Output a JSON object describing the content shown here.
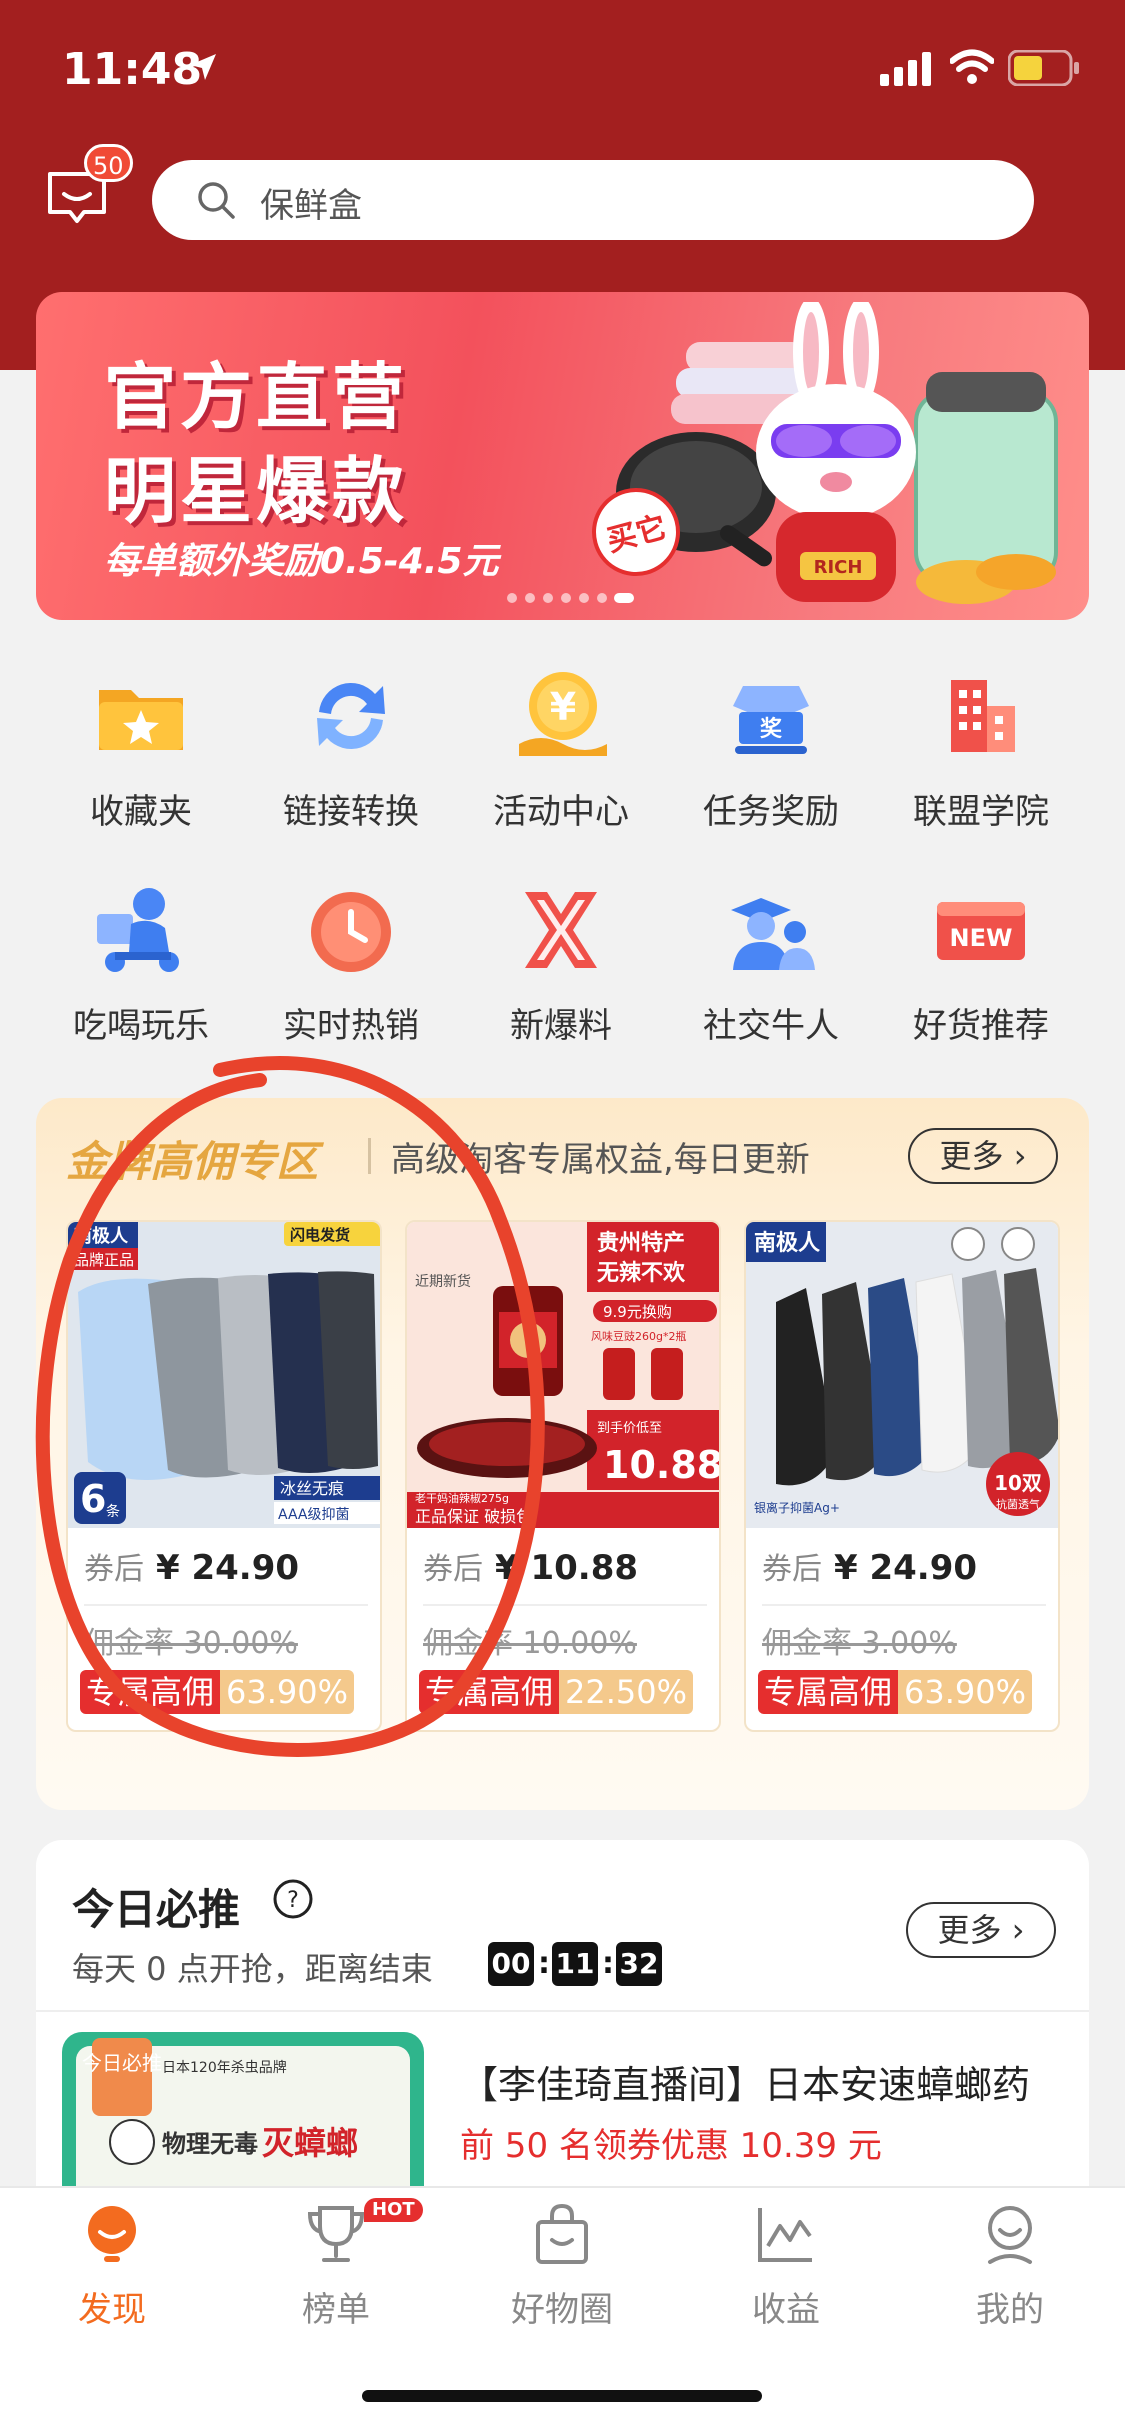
{
  "status_bar": {
    "time": "11:48"
  },
  "header": {
    "message_badge": "50",
    "search_placeholder": "保鲜盒"
  },
  "banner": {
    "title_line1": "官方直营",
    "title_line2": "明星爆款",
    "subtitle": "每单额外奖励0.5-4.5元",
    "stamp": "买它",
    "tag": "RICH"
  },
  "grid": {
    "items": [
      {
        "label": "收藏夹",
        "icon": "folder-star-icon"
      },
      {
        "label": "链接转换",
        "icon": "convert-arrows-icon"
      },
      {
        "label": "活动中心",
        "icon": "yuan-coin-icon"
      },
      {
        "label": "任务奖励",
        "icon": "award-icon"
      },
      {
        "label": "联盟学院",
        "icon": "buildings-icon"
      },
      {
        "label": "吃喝玩乐",
        "icon": "delivery-rider-icon"
      },
      {
        "label": "实时热销",
        "icon": "clock-icon"
      },
      {
        "label": "新爆料",
        "icon": "x-logo-icon"
      },
      {
        "label": "社交牛人",
        "icon": "graduate-people-icon"
      },
      {
        "label": "好货推荐",
        "icon": "new-badge-icon"
      }
    ]
  },
  "gold_zone": {
    "title": "金牌高佣专区",
    "subtitle": "高级淘客专属权益,每日更新",
    "more": "更多",
    "products": [
      {
        "price_prefix": "券后",
        "price": "¥ 24.90",
        "orig_rate": "佣金率 30.00%",
        "tag_label": "专属高佣",
        "tag_rate": "63.90%",
        "img_brand": "南极人",
        "img_badge": "闪电发货",
        "img_count": "6",
        "img_count_unit": "条",
        "img_note1": "冰丝无痕",
        "img_note2": "AAA级抑菌",
        "img_note3": "品牌正品"
      },
      {
        "price_prefix": "券后",
        "price": "¥ 10.88",
        "orig_rate": "佣金率 10.00%",
        "tag_label": "专属高佣",
        "tag_rate": "22.50%",
        "img_head1": "贵州特产",
        "img_head2": "无辣不欢",
        "img_promo": "9.9元换购",
        "img_promo2": "风味豆豉260g*2瓶",
        "img_label": "到手价低至",
        "img_price": "10.88",
        "img_foot": "正品保证 破损包",
        "img_bottle": "老干妈油辣椒275g",
        "img_fresh": "近期新货"
      },
      {
        "price_prefix": "券后",
        "price": "¥ 24.90",
        "orig_rate": "佣金率 3.00%",
        "tag_label": "专属高佣",
        "tag_rate": "63.90%",
        "img_brand": "南极人",
        "img_count": "10双",
        "img_sub": "抗菌透气",
        "img_note": "银离子抑菌Ag+"
      }
    ]
  },
  "today": {
    "title": "今日必推",
    "subtitle": "每天 0 点开抢，距离结束",
    "countdown": [
      "00",
      "11",
      "32"
    ],
    "more": "更多",
    "item": {
      "name": "【李佳琦直播间】日本安速蟑螂药",
      "coupon": "前 50 名领券优惠 10.39 元",
      "img_tag": "今日必推",
      "img_brand": "日本120年杀虫品牌",
      "img_title": "物理无毒",
      "img_title2": "灭蟑螂"
    }
  },
  "tabbar": {
    "tabs": [
      {
        "label": "发现",
        "icon": "discover-bulb-icon",
        "active": true
      },
      {
        "label": "榜单",
        "icon": "trophy-icon",
        "badge": "HOT"
      },
      {
        "label": "好物圈",
        "icon": "shopping-bag-icon"
      },
      {
        "label": "收益",
        "icon": "chart-line-icon"
      },
      {
        "label": "我的",
        "icon": "profile-face-icon"
      }
    ]
  },
  "colors": {
    "header": "#a31f1f",
    "accent_red": "#e52e2e",
    "tab_active": "#f36b1f",
    "gold": "#e5a640"
  }
}
